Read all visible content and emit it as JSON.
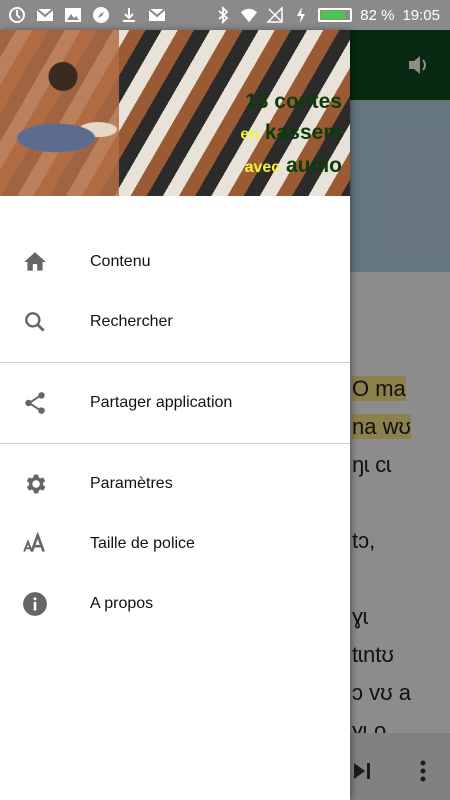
{
  "status_bar": {
    "battery": "82 %",
    "time": "19:05",
    "icons": [
      "notification-icon",
      "gmail-icon",
      "image-icon",
      "compass-icon",
      "download-icon",
      "mail-icon",
      "bluetooth-icon",
      "wifi-icon",
      "signal-icon",
      "charging-icon",
      "battery-icon"
    ]
  },
  "drawer": {
    "header_lines": [
      {
        "a": "13 contes",
        "b": ""
      },
      {
        "a": "en",
        "b": "kassem"
      },
      {
        "a": "avec",
        "b": "audio"
      }
    ],
    "groups": [
      [
        {
          "label": "Contenu",
          "icon": "home-icon"
        },
        {
          "label": "Rechercher",
          "icon": "search-icon"
        }
      ],
      [
        {
          "label": "Partager application",
          "icon": "share-icon"
        }
      ],
      [
        {
          "label": "Paramètres",
          "icon": "settings-icon"
        },
        {
          "label": "Taille de police",
          "icon": "font-size-icon"
        },
        {
          "label": "A propos",
          "icon": "info-icon"
        }
      ]
    ]
  },
  "background": {
    "story_lines": [
      "O ma",
      "na wʊ",
      "ŋɩ cɩ",
      "",
      "tɔ,",
      "",
      "ɣɩ",
      "tɩntʊ",
      "ɔ vʊ a",
      "ɣɩ o"
    ]
  }
}
